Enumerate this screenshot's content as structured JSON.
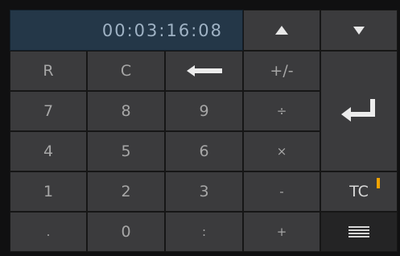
{
  "display": {
    "timecode": "00:03:16:08"
  },
  "nav": {
    "up_icon": "triangle-up-icon",
    "down_icon": "triangle-down-icon"
  },
  "keys": {
    "r": "R",
    "c": "C",
    "backspace_icon": "left-arrow-icon",
    "plusminus": "+/-",
    "seven": "7",
    "eight": "8",
    "nine": "9",
    "divide": "÷",
    "enter_icon": "enter-arrow-icon",
    "four": "4",
    "five": "5",
    "six": "6",
    "multiply": "×",
    "one": "1",
    "two": "2",
    "three": "3",
    "minus": "-",
    "tc": "TC",
    "dot": ".",
    "zero": "0",
    "colon": ":",
    "plus": "+",
    "menu_icon": "menu-lines-icon"
  },
  "colors": {
    "display_bg": "#243748",
    "key_bg": "#3b3b3d",
    "tc_indicator": "#f2a300"
  }
}
